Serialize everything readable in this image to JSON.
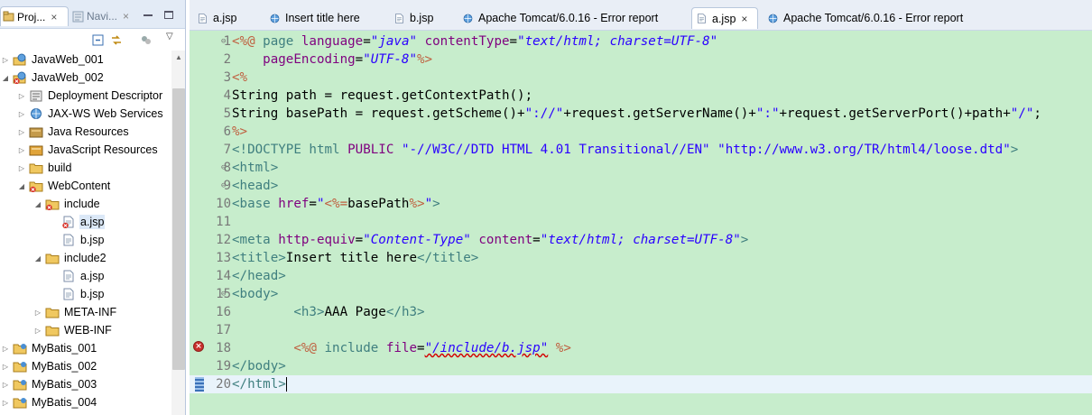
{
  "left_panel": {
    "tabs": [
      {
        "label": "Proj...",
        "close": "×"
      },
      {
        "label": "Navi...",
        "close": "×"
      }
    ],
    "tree": [
      {
        "label": "JavaWeb_001",
        "level": 0,
        "twisty": "▷",
        "icon": "web-project-icon"
      },
      {
        "label": "JavaWeb_002",
        "level": 0,
        "twisty": "◢",
        "icon": "web-project-error-icon"
      },
      {
        "label": "Deployment Descriptor",
        "level": 1,
        "twisty": "▷",
        "icon": "deployment-descriptor-icon"
      },
      {
        "label": "JAX-WS Web Services",
        "level": 1,
        "twisty": "▷",
        "icon": "web-services-icon"
      },
      {
        "label": "Java Resources",
        "level": 1,
        "twisty": "▷",
        "icon": "java-resources-icon"
      },
      {
        "label": "JavaScript Resources",
        "level": 1,
        "twisty": "▷",
        "icon": "javascript-resources-icon"
      },
      {
        "label": "build",
        "level": 1,
        "twisty": "▷",
        "icon": "folder-icon"
      },
      {
        "label": "WebContent",
        "level": 1,
        "twisty": "◢",
        "icon": "folder-error-icon"
      },
      {
        "label": "include",
        "level": 2,
        "twisty": "◢",
        "icon": "folder-error-icon"
      },
      {
        "label": "a.jsp",
        "level": 3,
        "twisty": "",
        "icon": "jsp-file-error-icon",
        "selected": true
      },
      {
        "label": "b.jsp",
        "level": 3,
        "twisty": "",
        "icon": "jsp-file-icon"
      },
      {
        "label": "include2",
        "level": 2,
        "twisty": "◢",
        "icon": "folder-icon"
      },
      {
        "label": "a.jsp",
        "level": 3,
        "twisty": "",
        "icon": "jsp-file-icon"
      },
      {
        "label": "b.jsp",
        "level": 3,
        "twisty": "",
        "icon": "jsp-file-icon"
      },
      {
        "label": "META-INF",
        "level": 2,
        "twisty": "▷",
        "icon": "folder-icon"
      },
      {
        "label": "WEB-INF",
        "level": 2,
        "twisty": "▷",
        "icon": "folder-icon"
      },
      {
        "label": "MyBatis_001",
        "level": 0,
        "twisty": "▷",
        "icon": "project-icon"
      },
      {
        "label": "MyBatis_002",
        "level": 0,
        "twisty": "▷",
        "icon": "project-icon"
      },
      {
        "label": "MyBatis_003",
        "level": 0,
        "twisty": "▷",
        "icon": "project-icon"
      },
      {
        "label": "MyBatis_004",
        "level": 0,
        "twisty": "▷",
        "icon": "project-icon"
      }
    ]
  },
  "editor": {
    "tabs": [
      {
        "label": "a.jsp",
        "icon": "jsp-file-icon",
        "active": false
      },
      {
        "label": "Insert title here",
        "icon": "web-browser-icon",
        "active": false
      },
      {
        "label": "b.jsp",
        "icon": "jsp-file-icon",
        "active": false
      },
      {
        "label": "Apache Tomcat/6.0.16 - Error report",
        "icon": "web-browser-icon",
        "active": false
      },
      {
        "label": "a.jsp",
        "icon": "jsp-file-icon",
        "active": true,
        "close": "×"
      },
      {
        "label": "Apache Tomcat/6.0.16 - Error report",
        "icon": "web-browser-icon",
        "active": false
      }
    ],
    "line_numbers": [
      "1",
      "2",
      "3",
      "4",
      "5",
      "6",
      "7",
      "8",
      "9",
      "10",
      "11",
      "12",
      "13",
      "14",
      "15",
      "16",
      "17",
      "18",
      "19",
      "20"
    ],
    "fold_markers": {
      "1": "⊖",
      "8": "⊖",
      "9": "⊖",
      "15": "⊖"
    },
    "error_line": "18",
    "current_line": "20",
    "code": [
      [
        [
          "t-jsp",
          "<%@ "
        ],
        [
          "t-dir",
          "page "
        ],
        [
          "t-attr",
          "language"
        ],
        [
          "t-plain",
          "="
        ],
        [
          "t-str",
          "\"java\""
        ],
        [
          "t-plain",
          " "
        ],
        [
          "t-attr",
          "contentType"
        ],
        [
          "t-plain",
          "="
        ],
        [
          "t-str",
          "\"text/html; charset=UTF-8\""
        ]
      ],
      [
        [
          "t-plain",
          "    "
        ],
        [
          "t-attr",
          "pageEncoding"
        ],
        [
          "t-plain",
          "="
        ],
        [
          "t-str",
          "\"UTF-8\""
        ],
        [
          "t-jsp",
          "%>"
        ]
      ],
      [
        [
          "t-jsp",
          "<%"
        ]
      ],
      [
        [
          "t-plain",
          "String path = request.getContextPath();"
        ]
      ],
      [
        [
          "t-plain",
          "String basePath = request.getScheme()+"
        ],
        [
          "t-aval",
          "\"://\""
        ],
        [
          "t-plain",
          "+request.getServerName()+"
        ],
        [
          "t-aval",
          "\":\""
        ],
        [
          "t-plain",
          "+request.getServerPort()+path+"
        ],
        [
          "t-aval",
          "\"/\""
        ],
        [
          "t-plain",
          ";"
        ]
      ],
      [
        [
          "t-jsp",
          "%>"
        ]
      ],
      [
        [
          "t-dtd",
          "<!DOCTYPE "
        ],
        [
          "t-dtd",
          "html "
        ],
        [
          "t-attr",
          "PUBLIC "
        ],
        [
          "t-aval",
          "\"-//W3C//DTD HTML 4.01 Transitional//EN\""
        ],
        [
          "t-plain",
          " "
        ],
        [
          "t-aval",
          "\"http://www.w3.org/TR/html4/loose.dtd\""
        ],
        [
          "t-dtd",
          ">"
        ]
      ],
      [
        [
          "t-tag",
          "<html>"
        ]
      ],
      [
        [
          "t-tag",
          "<head>"
        ]
      ],
      [
        [
          "t-tag",
          "<base "
        ],
        [
          "t-attr",
          "href"
        ],
        [
          "t-plain",
          "="
        ],
        [
          "t-aval",
          "\""
        ],
        [
          "t-jsp",
          "<%="
        ],
        [
          "t-plain",
          "basePath"
        ],
        [
          "t-jsp",
          "%>"
        ],
        [
          "t-aval",
          "\""
        ],
        [
          "t-tag",
          ">"
        ]
      ],
      [
        [
          "t-plain",
          ""
        ]
      ],
      [
        [
          "t-tag",
          "<meta "
        ],
        [
          "t-attr",
          "http-equiv"
        ],
        [
          "t-plain",
          "="
        ],
        [
          "t-str",
          "\"Content-Type\""
        ],
        [
          "t-plain",
          " "
        ],
        [
          "t-attr",
          "content"
        ],
        [
          "t-plain",
          "="
        ],
        [
          "t-str",
          "\"text/html; charset=UTF-8\""
        ],
        [
          "t-tag",
          ">"
        ]
      ],
      [
        [
          "t-tag",
          "<title>"
        ],
        [
          "t-plain",
          "Insert title here"
        ],
        [
          "t-tag",
          "</title>"
        ]
      ],
      [
        [
          "t-tag",
          "</head>"
        ]
      ],
      [
        [
          "t-tag",
          "<body>"
        ]
      ],
      [
        [
          "t-plain",
          "        "
        ],
        [
          "t-tag",
          "<h3>"
        ],
        [
          "t-plain",
          "AAA Page"
        ],
        [
          "t-tag",
          "</h3>"
        ]
      ],
      [
        [
          "t-plain",
          ""
        ]
      ],
      [
        [
          "t-plain",
          "        "
        ],
        [
          "t-jsp",
          "<%@ "
        ],
        [
          "t-dir",
          "include "
        ],
        [
          "t-attr",
          "file"
        ],
        [
          "t-plain",
          "="
        ],
        [
          "t-str t-warn",
          "\"/include/b.jsp\""
        ],
        [
          "t-plain",
          " "
        ],
        [
          "t-jsp",
          "%>"
        ]
      ],
      [
        [
          "t-tag",
          "</body>"
        ]
      ],
      [
        [
          "t-tag",
          "</html>"
        ]
      ]
    ]
  }
}
